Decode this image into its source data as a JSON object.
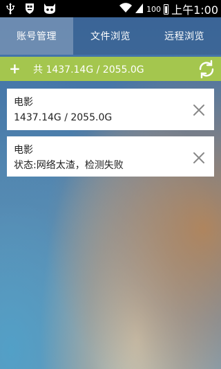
{
  "status_bar": {
    "battery_level": "100",
    "time": "上午1:00",
    "icons": [
      "usb-icon",
      "notification-shield-icon",
      "android-mascot-icon",
      "wifi-icon",
      "signal-icon",
      "battery-icon"
    ]
  },
  "tabs": [
    {
      "label": "账号管理",
      "active": true
    },
    {
      "label": "文件浏览",
      "active": false
    },
    {
      "label": "远程浏览",
      "active": false
    }
  ],
  "storage": {
    "add_label": "+",
    "total_text": "共 1437.14G / 2055.0G",
    "accent_color": "#a4c64e"
  },
  "accounts": [
    {
      "name": "电影",
      "info": "1437.14G / 2055.0G"
    },
    {
      "name": "电影",
      "info": "状态:网络太渣，检测失败"
    }
  ]
}
